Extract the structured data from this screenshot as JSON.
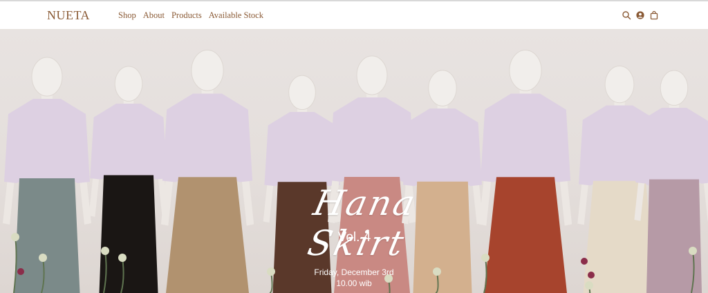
{
  "header": {
    "logo": "NUETA",
    "nav": [
      "Shop",
      "About",
      "Products",
      "Available Stock"
    ],
    "icons": [
      "search-icon",
      "account-icon",
      "cart-icon"
    ]
  },
  "hero": {
    "title": "Hana Skirt",
    "volume": "Vol. 4",
    "date": "Friday, December 3rd",
    "time": "10.00 wib",
    "skirt_colors": [
      "#7b8a89",
      "#1a1614",
      "#b1926f",
      "#5a382a",
      "#c98983",
      "#d3b08e",
      "#a7442d",
      "#e5dac8",
      "#b69aa6"
    ]
  },
  "colors": {
    "brand": "#8a5a35",
    "top": "#ddd0e2"
  }
}
